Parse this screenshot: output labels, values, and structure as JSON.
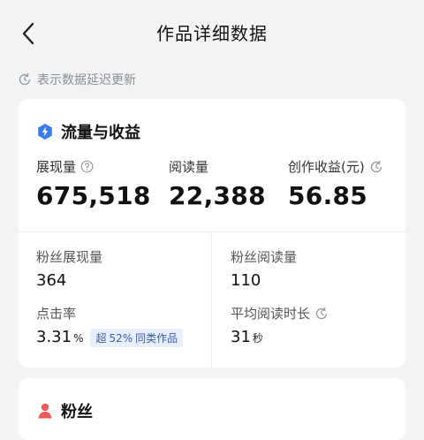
{
  "header": {
    "title": "作品详细数据"
  },
  "notice": {
    "text": "表示数据延迟更新"
  },
  "traffic_section": {
    "title": "流量与收益",
    "metrics": [
      {
        "label": "展现量",
        "value": "675,518"
      },
      {
        "label": "阅读量",
        "value": "22,388"
      },
      {
        "label": "创作收益(元)",
        "value": "56.85"
      }
    ],
    "fan_impressions": {
      "label": "粉丝展现量",
      "value": "364"
    },
    "fan_reads": {
      "label": "粉丝阅读量",
      "value": "110"
    },
    "ctr": {
      "label": "点击率",
      "value": "3.31",
      "unit": "%",
      "badge_prefix": "超",
      "badge_value": "52%",
      "badge_suffix": "同类作品"
    },
    "avg_read_time": {
      "label": "平均阅读时长",
      "value": "31",
      "unit": "秒"
    }
  },
  "fans_section": {
    "title": "粉丝"
  },
  "colors": {
    "accent_blue": "#3b7bf0",
    "fans_red": "#ef5a5a",
    "badge_bg": "#e8f0fe",
    "badge_text": "#3a5ca8"
  },
  "icons": {
    "back": "chevron-left-icon",
    "delay": "clock-refresh-icon",
    "traffic": "lightning-badge-icon",
    "help": "question-circle-icon",
    "fans": "person-icon"
  }
}
